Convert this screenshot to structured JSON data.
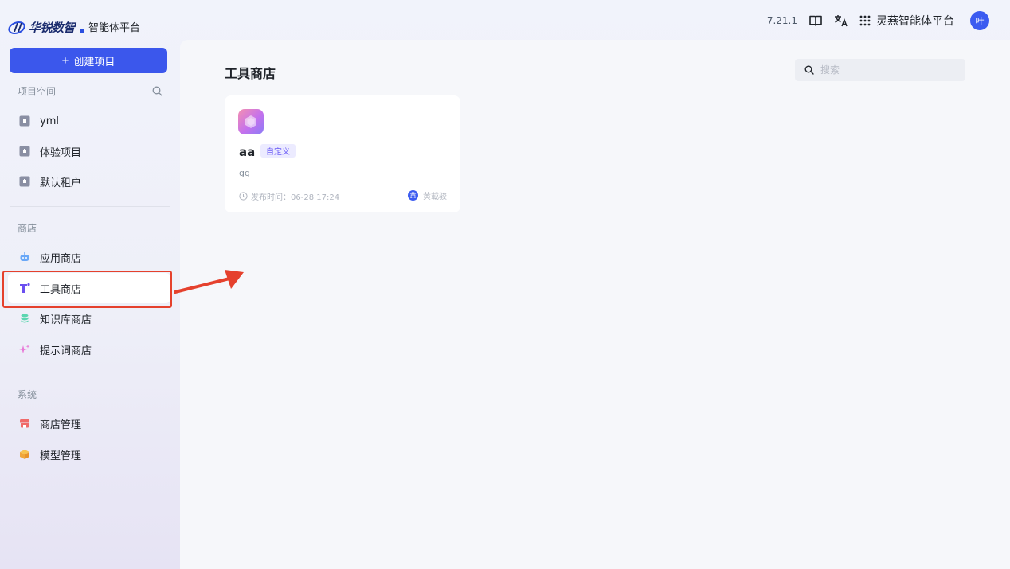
{
  "brand": {
    "name": "华锐数智",
    "subtitle": "智能体平台"
  },
  "header": {
    "version": "7.21.1",
    "app_switch_label": "灵燕智能体平台",
    "avatar_text": "叶"
  },
  "sidebar": {
    "create_button_label": "创建项目",
    "project_section_title": "项目空间",
    "projects": [
      {
        "label": "yml"
      },
      {
        "label": "体验项目"
      },
      {
        "label": "默认租户"
      }
    ],
    "store_section_title": "商店",
    "store_items": [
      {
        "label": "应用商店",
        "icon": "robot-icon"
      },
      {
        "label": "工具商店",
        "icon": "tool-icon"
      },
      {
        "label": "知识库商店",
        "icon": "database-icon"
      },
      {
        "label": "提示词商店",
        "icon": "sparkle-icon"
      }
    ],
    "system_section_title": "系统",
    "system_items": [
      {
        "label": "商店管理",
        "icon": "store-icon"
      },
      {
        "label": "模型管理",
        "icon": "cube-icon"
      }
    ]
  },
  "main": {
    "title": "工具商店",
    "search_placeholder": "搜索",
    "cards": [
      {
        "name": "aa",
        "tag": "自定义",
        "description": "gg",
        "published": "发布时间：06-28 17:24",
        "author_initial": "黄",
        "author": "黄載骏"
      }
    ]
  },
  "colors": {
    "accent": "#3b57ec",
    "highlight_border": "#e5412d",
    "tag_bg": "#ecebff",
    "tag_text": "#6b5cf6"
  }
}
